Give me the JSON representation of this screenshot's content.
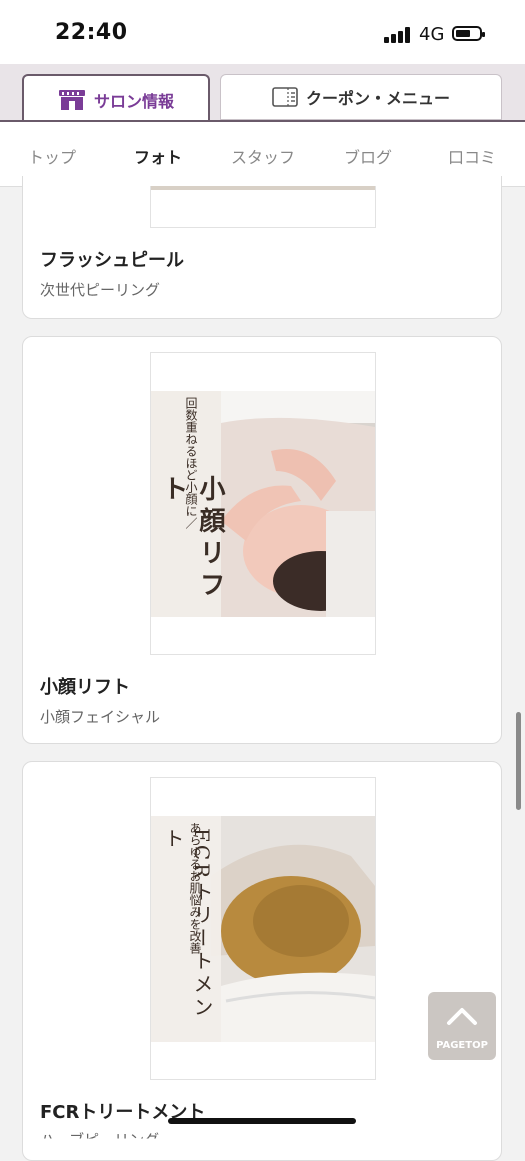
{
  "status_bar": {
    "time": "22:40",
    "network": "4G"
  },
  "top_tabs": [
    {
      "label": "サロン情報",
      "icon": "shop-icon",
      "active": true
    },
    {
      "label": "クーポン・メニュー",
      "icon": "document-icon",
      "active": false
    }
  ],
  "subnav": [
    {
      "label": "トップ"
    },
    {
      "label": "フォト"
    },
    {
      "label": "スタッフ"
    },
    {
      "label": "ブログ"
    },
    {
      "label": "口コミ"
    }
  ],
  "cards": [
    {
      "title": "フラッシュピール",
      "subtitle": "次世代ピーリング"
    },
    {
      "title": "小顔リフト",
      "subtitle": "小顔フェイシャル",
      "image_text": {
        "caption": "回数重ねるほど小顔に／",
        "headline": "小顔リフト"
      }
    },
    {
      "title": "FCRトリートメント",
      "subtitle": "ハーブピーリング",
      "image_text": {
        "caption": "あらゆるお肌悩みを改善",
        "headline": "FCRトリートメント"
      }
    }
  ],
  "page_top": {
    "label": "PAGETOP",
    "icon": "chevron-up-icon"
  },
  "colors": {
    "accent": "#7a3c97",
    "tab_border": "#6a5a6a"
  }
}
